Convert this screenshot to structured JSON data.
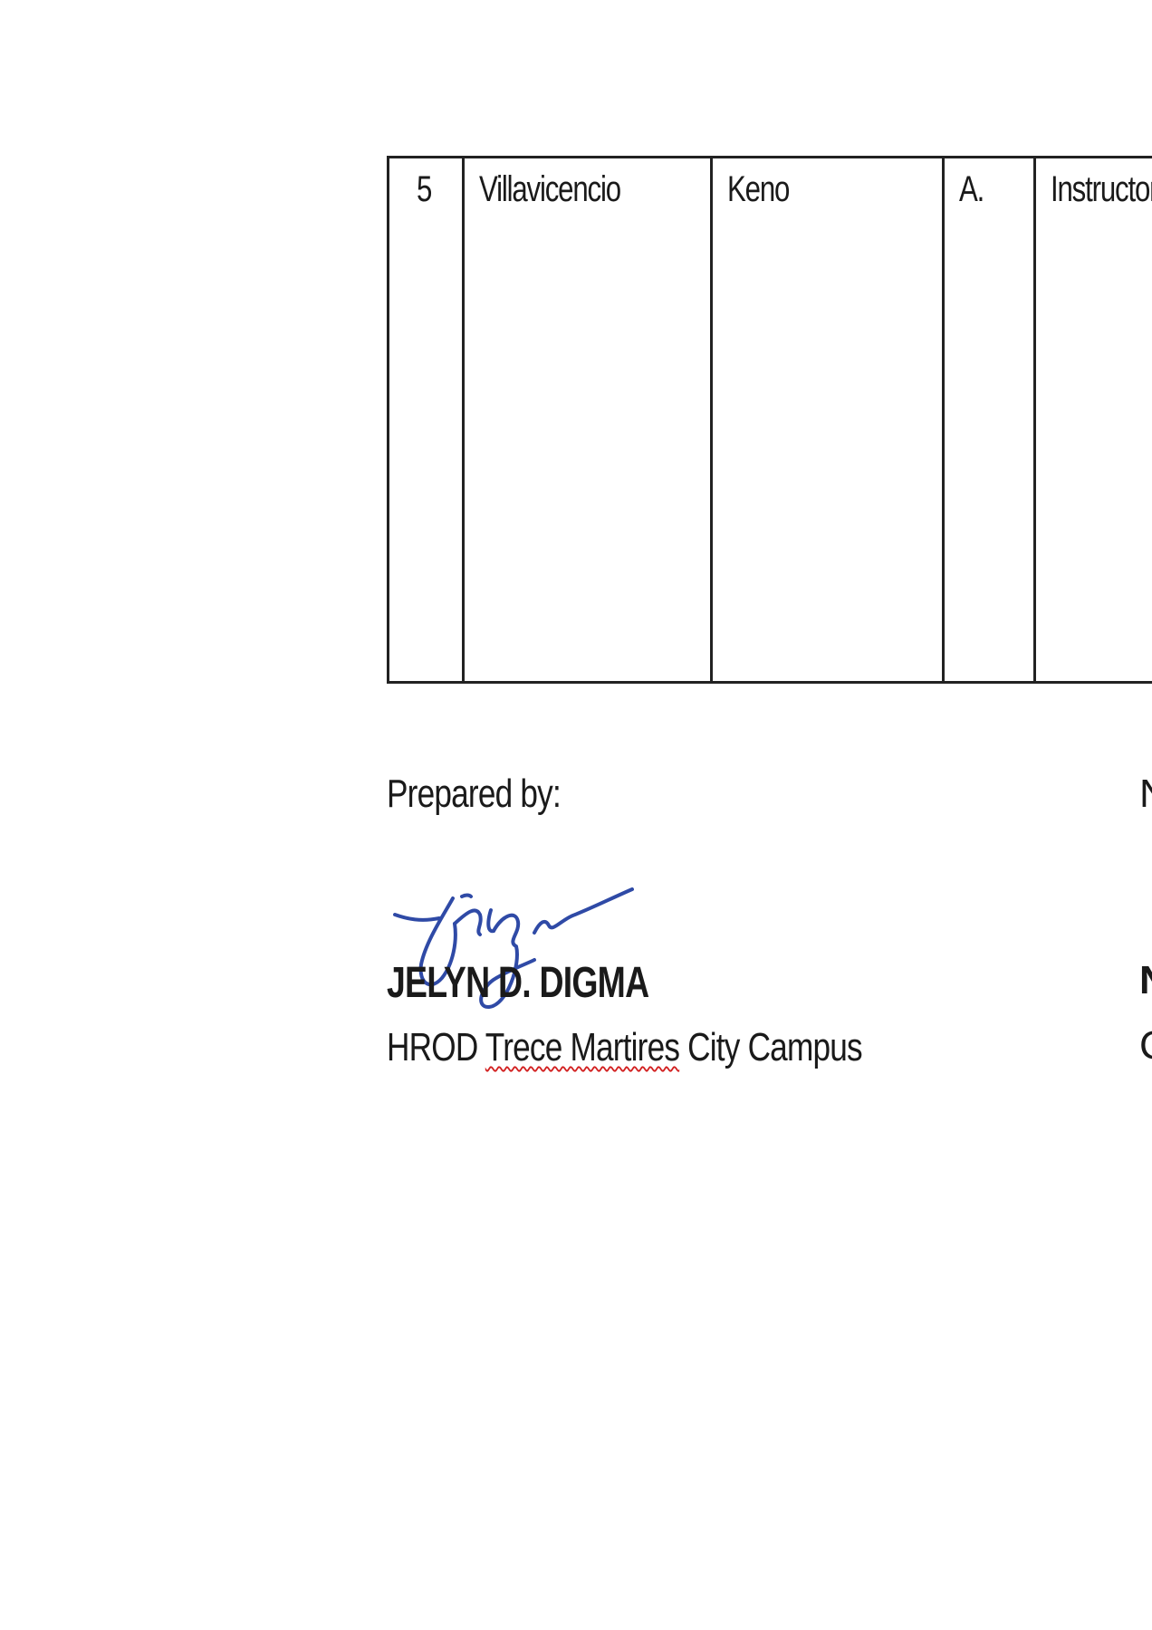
{
  "table": {
    "rows": [
      {
        "no": "5",
        "last_name": "Villavicencio",
        "first_name": "Keno",
        "middle_initial": "A.",
        "position": "Instructor I"
      }
    ]
  },
  "signature_block": {
    "prepared_label": "Prepared by:",
    "name": "JELYN D. DIGMA",
    "office_part1": "HROD",
    "office_spellcheck": "Trece Martires",
    "office_part2": "City Campus",
    "right_column_fragments": [
      "N",
      "N",
      "C"
    ]
  },
  "colors": {
    "text": "#1a1a1a",
    "border": "#222222",
    "signature_ink": "#2f4aa6",
    "spellcheck_underline": "#d21f1f"
  }
}
